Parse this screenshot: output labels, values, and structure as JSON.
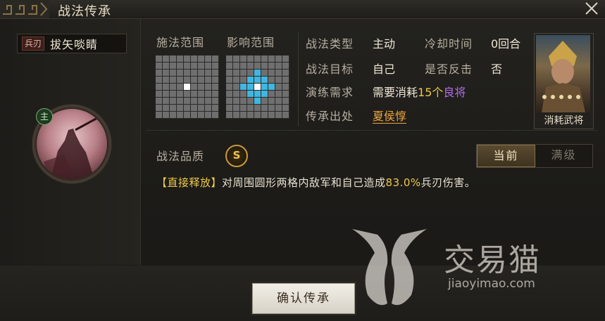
{
  "header": {
    "title": "战法传承"
  },
  "skill": {
    "type_badge": "兵刃",
    "name": "拔矢啖睛",
    "main_tag": "主"
  },
  "ranges": {
    "cast_label": "施法范围",
    "effect_label": "影响范围"
  },
  "info": {
    "type_label": "战法类型",
    "type_value": "主动",
    "cooldown_label": "冷却时间",
    "cooldown_value": "0回合",
    "target_label": "战法目标",
    "target_value": "自己",
    "counter_label": "是否反击",
    "counter_value": "否",
    "train_label": "演练需求",
    "train_prefix": "需要消耗",
    "train_count": "15个",
    "train_item": "良将",
    "source_label": "传承出处",
    "source_value": "夏侯惇"
  },
  "hero_card": {
    "caption": "消耗武将"
  },
  "quality": {
    "label": "战法品质",
    "grade": "S"
  },
  "level_toggle": {
    "current": "当前",
    "max": "满级"
  },
  "description": {
    "tag": "【直接释放】",
    "text_before": "对周围圆形两格内敌军和自己造成",
    "percent": "83.0%",
    "text_after": "兵刃伤害。"
  },
  "confirm_button": {
    "label": "确认传承"
  },
  "watermark": {
    "name": "交易猫",
    "url": "jiaoyimao.com"
  },
  "colors": {
    "accent_gold": "#eec84a",
    "link_orange": "#f0a840",
    "grid_blue": "#40b6e0"
  }
}
